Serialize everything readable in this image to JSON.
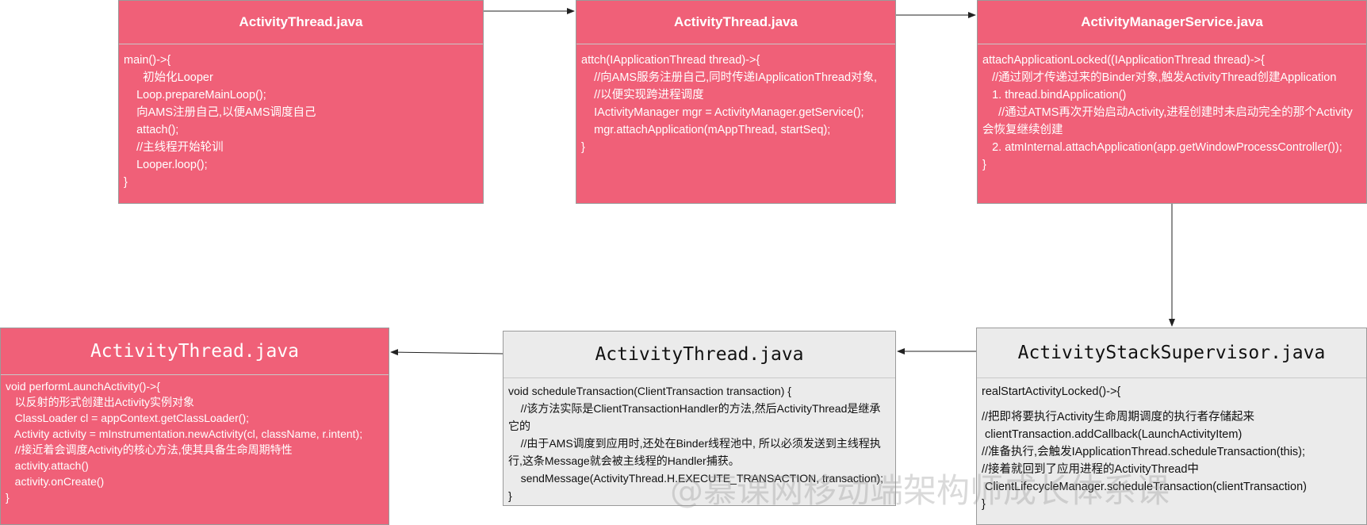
{
  "boxes": [
    {
      "title": "ActivityThread.java",
      "lines": [
        "main()->{",
        "      初始化Looper",
        "    Loop.prepareMainLoop();",
        "    向AMS注册自己,以便AMS调度自己",
        "    attach();",
        "    //主线程开始轮训",
        "    Looper.loop();",
        "}"
      ]
    },
    {
      "title": "ActivityThread.java",
      "lines": [
        "attch(IApplicationThread thread)->{",
        "    //向AMS服务注册自己,同时传递IApplicationThread对象,",
        "    //以便实现跨进程调度",
        "    IActivityManager mgr = ActivityManager.getService();",
        "    mgr.attachApplication(mAppThread, startSeq);",
        "}"
      ]
    },
    {
      "title": "ActivityManagerService.java",
      "lines": [
        "attachApplicationLocked((IApplicationThread thread)->{",
        "   //通过刚才传递过来的Binder对象,触发ActivityThread创建Application",
        "   1. thread.bindApplication()",
        "     //通过ATMS再次开始启动Activity,进程创建时未启动完全的那个Activity会恢复继续创建",
        "   2. atmInternal.attachApplication(app.getWindowProcessController());",
        "}"
      ]
    },
    {
      "title": "ActivityStackSupervisor.java",
      "lines": [
        "realStartActivityLocked()->{",
        "",
        "//把即将要执行Activity生命周期调度的执行者存储起来",
        " clientTransaction.addCallback(LaunchActivityItem)",
        "//准备执行,会触发IApplicationThread.scheduleTransaction(this);",
        "//接着就回到了应用进程的ActivityThread中",
        " ClientLifecycleManager.scheduleTransaction(clientTransaction)",
        "}"
      ]
    },
    {
      "title": "ActivityThread.java",
      "lines": [
        "void scheduleTransaction(ClientTransaction transaction) {",
        "    //该方法实际是ClientTransactionHandler的方法,然后ActivityThread是继承它的",
        "    //由于AMS调度到应用时,还处在Binder线程池中, 所以必须发送到主线程执行,这条Message就会被主线程的Handler捕获。",
        "    sendMessage(ActivityThread.H.EXECUTE_TRANSACTION, transaction);",
        "}"
      ]
    },
    {
      "title": "ActivityThread.java",
      "lines": [
        "void performLaunchActivity()->{",
        "   以反射的形式创建出Activity实例对象",
        "   ClassLoader cl = appContext.getClassLoader();",
        "   Activity activity = mInstrumentation.newActivity(cl, className, r.intent);",
        "",
        "   //接近着会调度Activity的核心方法,使其具备生命周期特性",
        "   activity.attach()",
        "   activity.onCreate()",
        "}"
      ]
    }
  ],
  "watermark": "@慕课网移动端架构师成长体系课",
  "colors": {
    "pink": "#f06078",
    "gray": "#ebebeb",
    "arrow": "#222222"
  }
}
